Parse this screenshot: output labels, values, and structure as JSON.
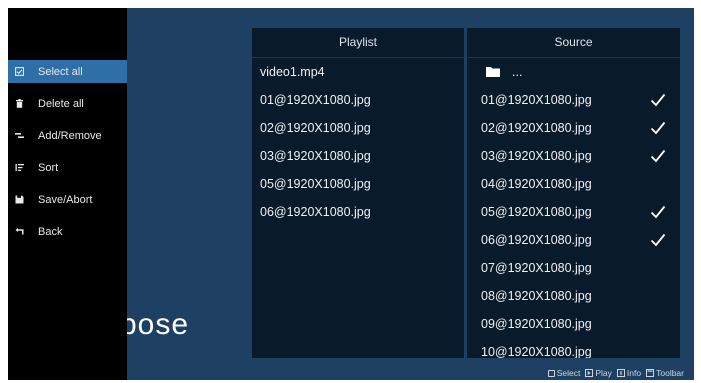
{
  "menu": {
    "items": [
      {
        "label": "Select all",
        "icon": "checkbox-icon",
        "selected": true
      },
      {
        "label": "Delete all",
        "icon": "trash-icon",
        "selected": false
      },
      {
        "label": "Add/Remove",
        "icon": "add-remove-icon",
        "selected": false
      },
      {
        "label": "Sort",
        "icon": "sort-icon",
        "selected": false
      },
      {
        "label": "Save/Abort",
        "icon": "save-icon",
        "selected": false
      },
      {
        "label": "Back",
        "icon": "back-icon",
        "selected": false
      }
    ]
  },
  "background_text": "pose",
  "playlist": {
    "title": "Playlist",
    "items": [
      "video1.mp4",
      "01@1920X1080.jpg",
      "02@1920X1080.jpg",
      "03@1920X1080.jpg",
      "05@1920X1080.jpg",
      "06@1920X1080.jpg"
    ]
  },
  "source": {
    "title": "Source",
    "parent_label": "...",
    "items": [
      {
        "name": "01@1920X1080.jpg",
        "checked": true
      },
      {
        "name": "02@1920X1080.jpg",
        "checked": true
      },
      {
        "name": "03@1920X1080.jpg",
        "checked": true
      },
      {
        "name": "04@1920X1080.jpg",
        "checked": false
      },
      {
        "name": "05@1920X1080.jpg",
        "checked": true
      },
      {
        "name": "06@1920X1080.jpg",
        "checked": true
      },
      {
        "name": "07@1920X1080.jpg",
        "checked": false
      },
      {
        "name": "08@1920X1080.jpg",
        "checked": false
      },
      {
        "name": "09@1920X1080.jpg",
        "checked": false
      },
      {
        "name": "10@1920X1080.jpg",
        "checked": false
      }
    ]
  },
  "hints": {
    "select": "Select",
    "play": "Play",
    "info": "Info",
    "toolbar": "Toolbar"
  },
  "colors": {
    "background": "#1d4063",
    "sidebar": "#000000",
    "selected": "#2f6fa8",
    "panel": "#091a2b"
  }
}
